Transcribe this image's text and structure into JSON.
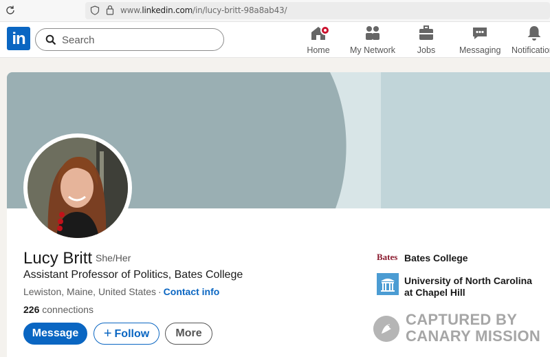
{
  "browser": {
    "url_prefix": "www.",
    "url_domain": "linkedin.com",
    "url_path": "/in/lucy-britt-98a8ab43/"
  },
  "nav": {
    "logo": "in",
    "search_placeholder": "Search",
    "items": [
      {
        "label": "Home",
        "icon": "home-icon"
      },
      {
        "label": "My Network",
        "icon": "network-icon"
      },
      {
        "label": "Jobs",
        "icon": "briefcase-icon"
      },
      {
        "label": "Messaging",
        "icon": "chat-icon"
      },
      {
        "label": "Notifications",
        "icon": "bell-icon"
      }
    ]
  },
  "profile": {
    "name": "Lucy Britt",
    "pronouns": "She/Her",
    "headline": "Assistant Professor of Politics, Bates College",
    "location": "Lewiston, Maine, United States",
    "separator": "·",
    "contact_link": "Contact info",
    "connections_count": "226",
    "connections_label": "connections",
    "buttons": {
      "message": "Message",
      "follow": "Follow",
      "more": "More"
    }
  },
  "education": [
    {
      "logo_text": "Bates",
      "name": "Bates College"
    },
    {
      "name": "University of North Carolina at Chapel Hill"
    }
  ],
  "watermark": {
    "line1": "CAPTURED BY",
    "line2": "CANARY MISSION"
  },
  "colors": {
    "linkedin_blue": "#0a66c2",
    "banner_dark": "#9aafb3",
    "banner_light": "#bfd4d8",
    "notification_red": "#cb112d"
  }
}
